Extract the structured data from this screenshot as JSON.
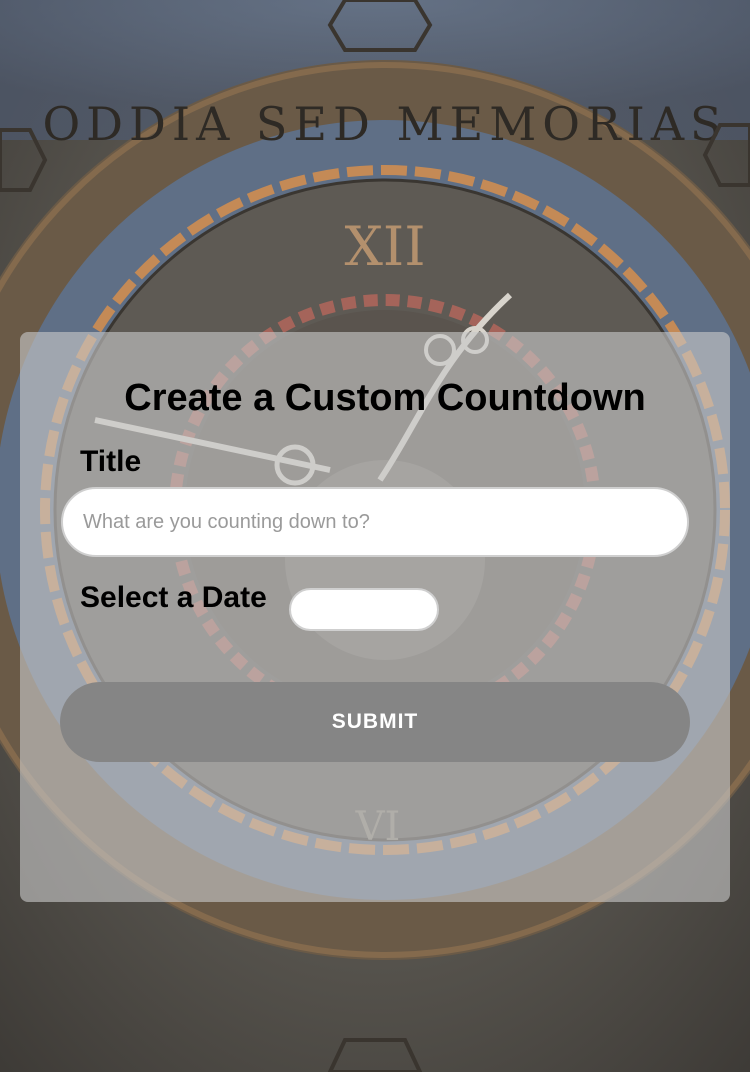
{
  "colors": {
    "card_background": "#c8c8c8",
    "submit_button": "#858585",
    "input_border": "#cfcfcf",
    "placeholder_text": "#9a9a9a"
  },
  "background": {
    "icon": "clock-face-image",
    "motto": "ODDIA SED MEMORIAS",
    "numeral_top": "XII",
    "numeral_bottom": "VI"
  },
  "form": {
    "heading": "Create a Custom Countdown",
    "title_label": "Title",
    "title_value": "",
    "title_placeholder": "What are you counting down to?",
    "date_label": "Select a Date",
    "date_value": "",
    "submit_label": "SUBMIT"
  }
}
